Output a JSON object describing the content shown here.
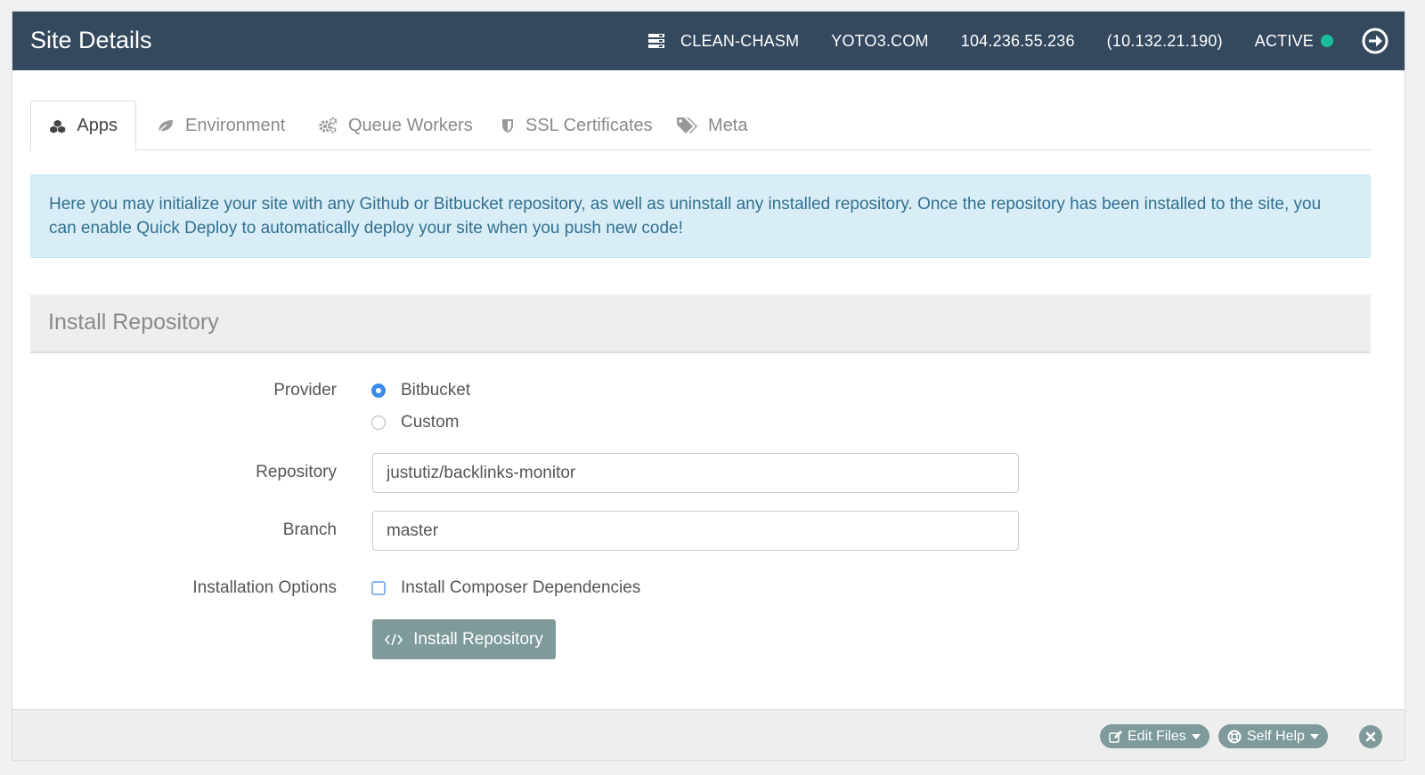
{
  "header": {
    "title": "Site Details",
    "server_name": "CLEAN-CHASM",
    "domain": "YOTO3.COM",
    "public_ip": "104.236.55.236",
    "private_ip": "(10.132.21.190)",
    "status": "ACTIVE",
    "status_color": "#1abc9c"
  },
  "tabs": [
    {
      "label": "Apps",
      "icon": "cubes-icon",
      "active": true
    },
    {
      "label": "Environment",
      "icon": "leaf-icon"
    },
    {
      "label": "Queue Workers",
      "icon": "gears-icon"
    },
    {
      "label": "SSL Certificates",
      "icon": "shield-icon"
    },
    {
      "label": "Meta",
      "icon": "tags-icon"
    }
  ],
  "alert": {
    "text": "Here you may initialize your site with any Github or Bitbucket repository, as well as uninstall any installed repository. Once the repository has been installed to the site, you can enable Quick Deploy to automatically deploy your site when you push new code!"
  },
  "install": {
    "heading": "Install Repository",
    "provider_label": "Provider",
    "providers": [
      "Bitbucket",
      "Custom"
    ],
    "selected_provider": "Bitbucket",
    "repository_label": "Repository",
    "repository_value": "justutiz/backlinks-monitor",
    "branch_label": "Branch",
    "branch_value": "master",
    "options_label": "Installation Options",
    "composer_option": "Install Composer Dependencies",
    "composer_checked": false,
    "button_label": "Install Repository"
  },
  "footer": {
    "edit_files": "Edit Files",
    "self_help": "Self Help"
  },
  "colors": {
    "header_bg": "#34495e",
    "button_bg": "#7f9a9a",
    "alert_bg": "#d9edf7",
    "radio_on": "#3b8beb"
  }
}
